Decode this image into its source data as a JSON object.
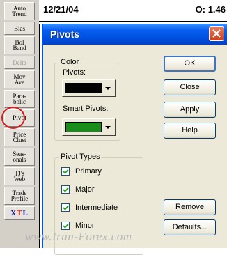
{
  "toolbar": {
    "items": [
      {
        "label": "Auto\nTrend"
      },
      {
        "label": "Bias"
      },
      {
        "label": "Bol\nBand"
      },
      {
        "label": "Delta"
      },
      {
        "label": "Mov\nAve"
      },
      {
        "label": "Para-\nbolic"
      },
      {
        "label": "Pivot"
      },
      {
        "label": "Price\nClust"
      },
      {
        "label": "Seas-\nonals"
      },
      {
        "label": "TJ's\nWeb"
      },
      {
        "label": "Trade\nProfile"
      },
      {
        "label_x": "X",
        "label_t": "T",
        "label_l": "L"
      }
    ]
  },
  "chart_header": {
    "date": "12/21/04",
    "value": "O: 1.46"
  },
  "dialog": {
    "title": "Pivots",
    "color_group": {
      "legend": "Color",
      "pivots_label": "Pivots:",
      "pivots_color": "#000000",
      "smart_pivots_label": "Smart Pivots:",
      "smart_pivots_color": "#1a8c1a"
    },
    "pivot_types": {
      "legend": "Pivot Types",
      "items": [
        {
          "label": "Primary",
          "checked": true
        },
        {
          "label": "Major",
          "checked": true
        },
        {
          "label": "Intermediate",
          "checked": true
        },
        {
          "label": "Minor",
          "checked": true
        }
      ]
    },
    "buttons": {
      "ok": "OK",
      "close": "Close",
      "apply": "Apply",
      "help": "Help",
      "remove": "Remove",
      "defaults": "Defaults..."
    }
  },
  "watermark": "www.Iran-Forex.com",
  "colors": {
    "titlebar": "#0054e3",
    "dialog_bg": "#ece9d8",
    "highlight_circle": "#d42020"
  }
}
